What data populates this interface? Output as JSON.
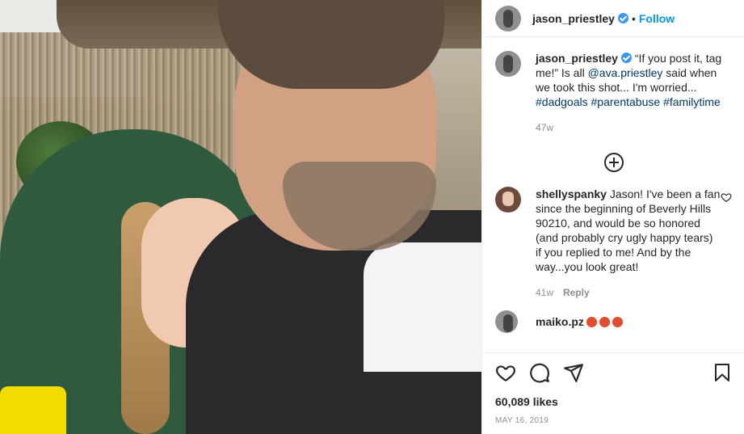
{
  "post": {
    "username": "jason_priestley",
    "follow_label": "Follow",
    "dot": "•"
  },
  "caption": {
    "username": "jason_priestley",
    "text_before": " “If you post it, tag me!” Is all ",
    "mention": "@ava.priestley",
    "text_after": " said when we took this shot... I'm worried...",
    "hashtags": [
      "#dadgoals",
      "#parentabuse",
      "#familytime"
    ],
    "age": "47w"
  },
  "comments": [
    {
      "username": "shellyspanky",
      "text": " Jason! I've been a fan since the beginning of Beverly Hills 90210, and would be so honored (and probably cry ugly happy tears) if you replied to me! And by the way...you look great!",
      "age": "41w",
      "reply_label": "Reply"
    },
    {
      "username": "maiko.pz"
    }
  ],
  "stats": {
    "likes": "60,089 likes",
    "date": "MAY 16, 2019"
  },
  "icons": [
    "heart-icon",
    "comment-icon",
    "share-icon",
    "save-icon",
    "add-comment-icon",
    "verified-badge-icon"
  ],
  "colors": {
    "accent": "#0095f6",
    "verified": "#3897f0",
    "muted": "#8e8e8e"
  }
}
